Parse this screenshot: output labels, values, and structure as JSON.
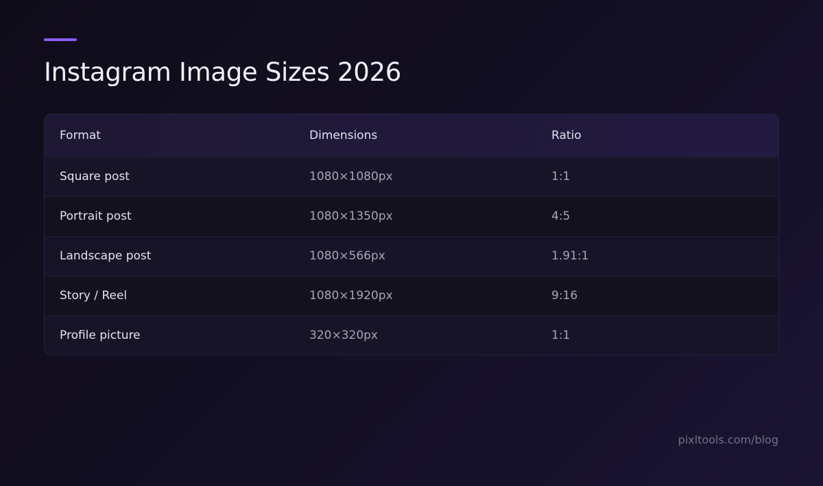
{
  "page": {
    "title": "Instagram Image Sizes 2026",
    "credit": "pixltools.com/blog",
    "accent_color": "#8b5cf6"
  },
  "table": {
    "headers": [
      "Format",
      "Dimensions",
      "Ratio"
    ],
    "rows": [
      {
        "format": "Square post",
        "dimensions": "1080×1080px",
        "ratio": "1:1"
      },
      {
        "format": "Portrait post",
        "dimensions": "1080×1350px",
        "ratio": "4:5"
      },
      {
        "format": "Landscape post",
        "dimensions": "1080×566px",
        "ratio": "1.91:1"
      },
      {
        "format": "Story / Reel",
        "dimensions": "1080×1920px",
        "ratio": "9:16"
      },
      {
        "format": "Profile picture",
        "dimensions": "320×320px",
        "ratio": "1:1"
      }
    ]
  }
}
